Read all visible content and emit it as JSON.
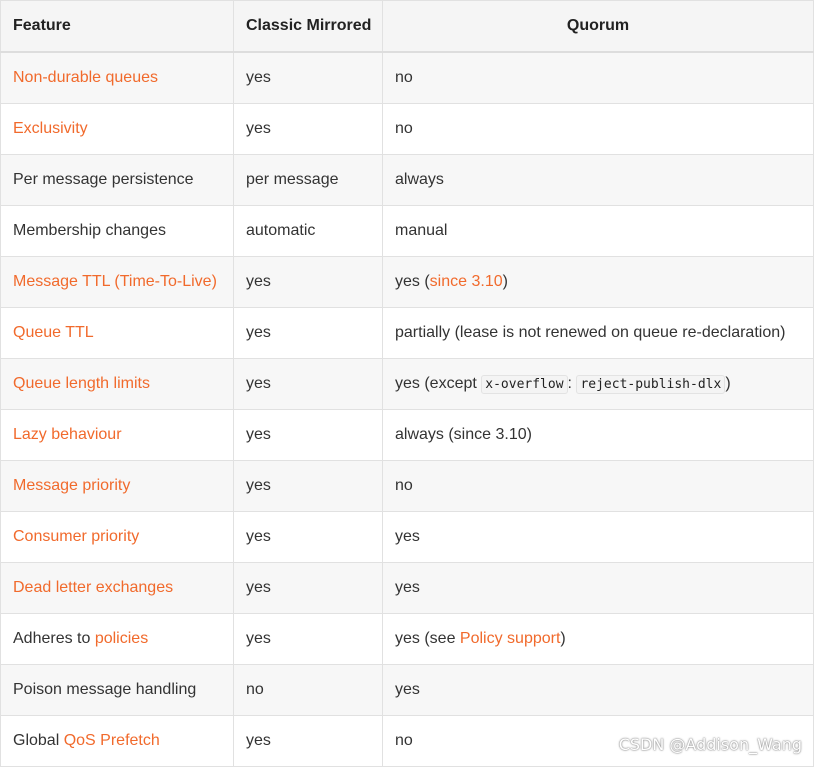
{
  "headers": [
    "Feature",
    "Classic Mirrored",
    "Quorum"
  ],
  "rows": [
    {
      "feature": "Non-durable queues",
      "classic": "yes",
      "quorum": "no"
    },
    {
      "feature": "Exclusivity",
      "classic": "yes",
      "quorum": "no"
    },
    {
      "feature": "Per message persistence",
      "classic": "per message",
      "quorum": "always"
    },
    {
      "feature": "Membership changes",
      "classic": "automatic",
      "quorum": "manual"
    },
    {
      "feature": "Message TTL (Time-To-Live)",
      "classic": "yes",
      "quorum_pre": "yes (",
      "quorum_link": "since 3.10",
      "quorum_post": ")"
    },
    {
      "feature": "Queue TTL",
      "classic": "yes",
      "quorum": "partially (lease is not renewed on queue re-declaration)"
    },
    {
      "feature": "Queue length limits",
      "classic": "yes",
      "quorum_pre": "yes (except ",
      "code1": "x-overflow",
      "sep": ": ",
      "code2": "reject-publish-dlx",
      "quorum_post": ")"
    },
    {
      "feature": "Lazy behaviour",
      "classic": "yes",
      "quorum": "always (since 3.10)"
    },
    {
      "feature": "Message priority",
      "classic": "yes",
      "quorum": "no"
    },
    {
      "feature": "Consumer priority",
      "classic": "yes",
      "quorum": "yes"
    },
    {
      "feature": "Dead letter exchanges",
      "classic": "yes",
      "quorum": "yes"
    },
    {
      "feature_pre": "Adheres to ",
      "feature_link": "policies",
      "classic": "yes",
      "quorum_pre": "yes (see ",
      "quorum_link": "Policy support",
      "quorum_post": ")"
    },
    {
      "feature": "Poison message handling",
      "classic": "no",
      "quorum": "yes"
    },
    {
      "feature_pre": "Global ",
      "feature_link": "QoS Prefetch",
      "classic": "yes",
      "quorum": "no"
    }
  ],
  "watermark": "CSDN @Addison_Wang",
  "colors": {
    "link": "#f16a2c",
    "header_bg": "#f5f5f5",
    "stripe": "#f7f7f7"
  }
}
